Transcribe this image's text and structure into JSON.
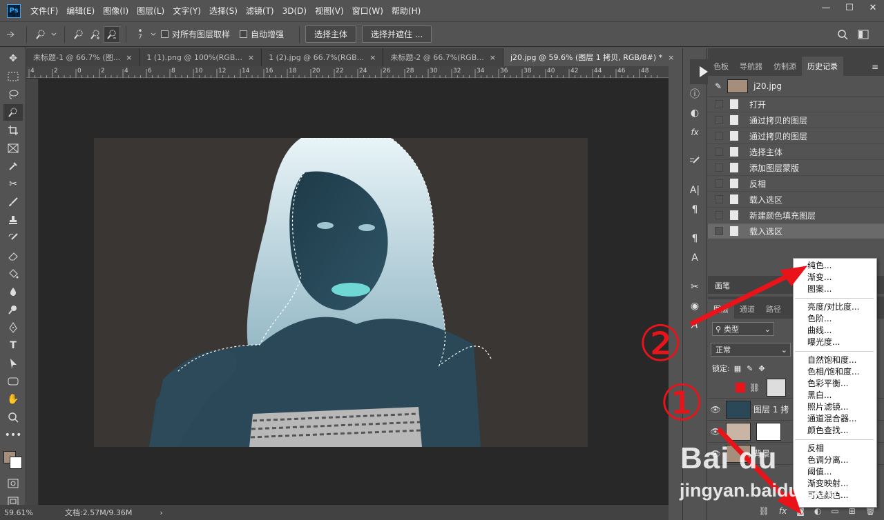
{
  "app": {
    "logo": "Ps"
  },
  "menubar": {
    "items": [
      "文件(F)",
      "编辑(E)",
      "图像(I)",
      "图层(L)",
      "文字(Y)",
      "选择(S)",
      "滤镜(T)",
      "3D(D)",
      "视图(V)",
      "窗口(W)",
      "帮助(H)"
    ],
    "window_controls": [
      "—",
      "☐",
      "✕"
    ]
  },
  "options": {
    "size_value": "7",
    "sample_all_layers": "对所有图层取样",
    "auto_enhance": "自动增强",
    "select_subject": "选择主体",
    "select_and_mask": "选择并遮住 ..."
  },
  "tabs": [
    {
      "label": "未标题-1 @ 66.7% (图..."
    },
    {
      "label": "1 (1).png @ 100%(RGB..."
    },
    {
      "label": "1 (2).jpg @ 66.7%(RGB..."
    },
    {
      "label": "未标题-2 @ 66.7%(RGB..."
    },
    {
      "label": "j20.jpg @ 59.6% (图层 1 拷贝, RGB/8#) *"
    }
  ],
  "ruler": {
    "ticks": [
      "4",
      "2",
      "0",
      "2",
      "4",
      "6",
      "8",
      "10",
      "12",
      "14",
      "16",
      "18",
      "20",
      "22",
      "24",
      "26",
      "28",
      "30",
      "32",
      "34",
      "36",
      "38",
      "40",
      "42",
      "44",
      "46",
      "48"
    ]
  },
  "status": {
    "zoom": "59.61%",
    "doc": "文档:2.57M/9.36M"
  },
  "history": {
    "tabs": [
      "色板",
      "导航器",
      "仿制源",
      "历史记录"
    ],
    "snapshot": "j20.jpg",
    "steps": [
      "打开",
      "通过拷贝的图层",
      "通过拷贝的图层",
      "选择主体",
      "添加图层蒙版",
      "反相",
      "载入选区",
      "新建颜色填充图层",
      "载入选区"
    ]
  },
  "brush_strip": {
    "label": "画笔"
  },
  "layers": {
    "tabs": [
      "图层",
      "通道",
      "路径"
    ],
    "filter_kind": "类型",
    "blend_mode": "正常",
    "lock_label": "锁定:",
    "layer_names": [
      "",
      "图层 1 拷",
      "",
      "背景"
    ]
  },
  "context_menu": {
    "group1": [
      "纯色...",
      "渐变...",
      "图案..."
    ],
    "group2": [
      "亮度/对比度...",
      "色阶...",
      "曲线...",
      "曝光度..."
    ],
    "group3": [
      "自然饱和度...",
      "色相/饱和度...",
      "色彩平衡...",
      "黑白...",
      "照片滤镜...",
      "通道混合器...",
      "颜色查找..."
    ],
    "group4": [
      "反相",
      "色调分离...",
      "阈值...",
      "渐变映射...",
      "可选颜色..."
    ]
  },
  "annotations": {
    "step1": "①",
    "step2": "②"
  },
  "watermark": {
    "line1": "Bai du",
    "line2": "jingyan.baidu.com"
  },
  "colors": {
    "accent_red": "#e8141a",
    "foreground": "#a58f7c",
    "background": "#ffffff",
    "ps_blue": "#31a8ff"
  }
}
